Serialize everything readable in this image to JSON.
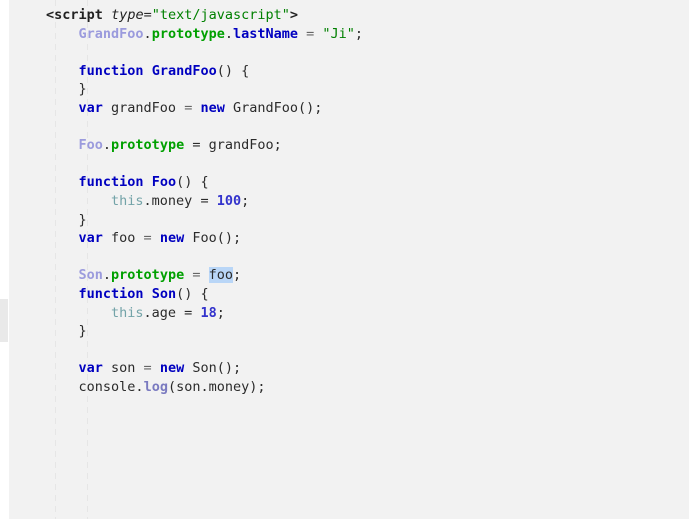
{
  "editor": {
    "background_color": "#f2f2f2",
    "page_background_color": "#ffffff",
    "selection_color": "#b9d6f7",
    "language": "html-javascript",
    "scrollbar": {
      "name": "vertical-scroll-thumb",
      "color": "#e9e9e9"
    }
  },
  "colors": {
    "keyword": "#0000c0",
    "string": "#008000",
    "identifier": "#9b9bdd",
    "prototype": "#00a000",
    "property": "#0000c0",
    "this": "#73a3a8",
    "number": "#3333cc",
    "method": "#7a7ac0",
    "plain": "#2b2b2b"
  },
  "code": {
    "lines": [
      {
        "n": 1,
        "text": "<script type=\"text/javascript\">"
      },
      {
        "n": 2,
        "text": "    GrandFoo.prototype.lastName = \"Ji\";"
      },
      {
        "n": 3,
        "text": ""
      },
      {
        "n": 4,
        "text": "    function GrandFoo() {"
      },
      {
        "n": 5,
        "text": "    }"
      },
      {
        "n": 6,
        "text": "    var grandFoo = new GrandFoo();"
      },
      {
        "n": 7,
        "text": ""
      },
      {
        "n": 8,
        "text": "    Foo.prototype = grandFoo;"
      },
      {
        "n": 9,
        "text": ""
      },
      {
        "n": 10,
        "text": "    function Foo() {"
      },
      {
        "n": 11,
        "text": "        this.money = 100;"
      },
      {
        "n": 12,
        "text": "    }"
      },
      {
        "n": 13,
        "text": "    var foo = new Foo();"
      },
      {
        "n": 14,
        "text": ""
      },
      {
        "n": 15,
        "text": "    Son.prototype = foo;"
      },
      {
        "n": 16,
        "text": "    function Son() {"
      },
      {
        "n": 17,
        "text": "        this.age = 18;"
      },
      {
        "n": 18,
        "text": "    }"
      },
      {
        "n": 19,
        "text": ""
      },
      {
        "n": 20,
        "text": "    var son = new Son();"
      },
      {
        "n": 21,
        "text": "    console.log(son.money);"
      }
    ],
    "selection": {
      "text": "foo",
      "line": 15,
      "caret_after": true
    }
  },
  "tokens": {
    "l1": {
      "open": "<",
      "tag": "script",
      "sp": " ",
      "attr": "type",
      "eq": "=",
      "value": "\"text/javascript\"",
      "close": ">"
    },
    "l2": {
      "obj": "GrandFoo",
      "dot1": ".",
      "proto": "prototype",
      "dot2": ".",
      "prop": "lastName",
      "eq": " = ",
      "val": "\"Ji\"",
      "semi": ";"
    },
    "l4": {
      "kw": "function",
      "name": "GrandFoo",
      "rest": "() {"
    },
    "l5": {
      "brace": "}"
    },
    "l6": {
      "kw": "var",
      "name": " grandFoo ",
      "eq": "= ",
      "newkw": "new",
      "call": " GrandFoo();"
    },
    "l8": {
      "obj": "Foo",
      "dot": ".",
      "proto": "prototype",
      "rest": " = grandFoo;"
    },
    "l10": {
      "kw": "function",
      "name": "Foo",
      "rest": "() {"
    },
    "l11": {
      "this": "this",
      "prop": ".money = ",
      "num": "100",
      "semi": ";"
    },
    "l12": {
      "brace": "}"
    },
    "l13": {
      "kw": "var",
      "name": " foo ",
      "eq": "= ",
      "newkw": "new",
      "call": " Foo();"
    },
    "l15": {
      "obj": "Son",
      "dot": ".",
      "proto": "prototype",
      "eq": " = ",
      "sel": "foo",
      "semi": ";"
    },
    "l16": {
      "kw": "function",
      "name": "Son",
      "rest": "() {"
    },
    "l17": {
      "this": "this",
      "prop": ".age = ",
      "num": "18",
      "semi": ";"
    },
    "l18": {
      "brace": "}"
    },
    "l20": {
      "kw": "var",
      "name": " son ",
      "eq": "= ",
      "newkw": "new",
      "call": " Son();"
    },
    "l21": {
      "obj": "console",
      "dot": ".",
      "method": "log",
      "rest": "(son.money);"
    }
  }
}
